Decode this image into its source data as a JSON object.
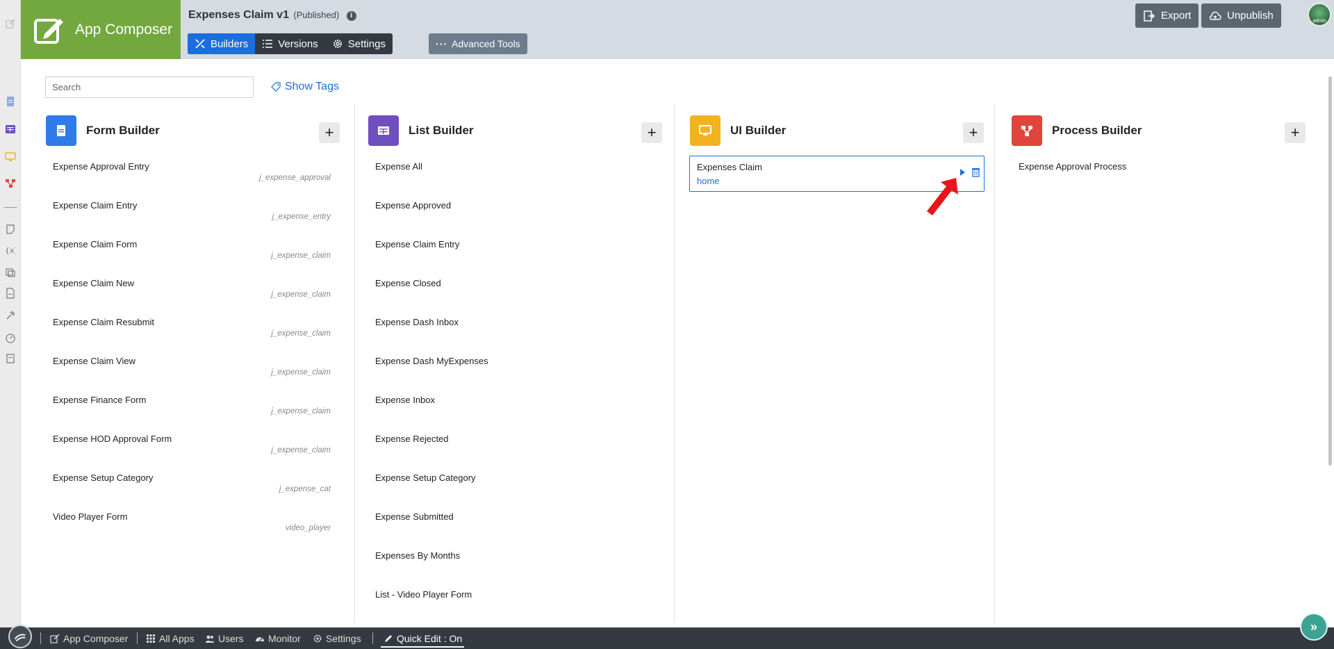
{
  "header": {
    "brand": "App Composer",
    "app_title": "Expenses Claim v1",
    "app_status": "(Published)",
    "tabs": [
      {
        "label": "Builders"
      },
      {
        "label": "Versions"
      },
      {
        "label": "Settings"
      }
    ],
    "advanced_tools": "Advanced Tools",
    "export_label": "Export",
    "unpublish_label": "Unpublish",
    "avatar_text": "admin"
  },
  "toolbar": {
    "search_placeholder": "Search",
    "show_tags": "Show Tags"
  },
  "columns": {
    "form": {
      "title": "Form Builder",
      "items": [
        {
          "name": "Expense Approval Entry",
          "table": "j_expense_approval"
        },
        {
          "name": "Expense Claim Entry",
          "table": "j_expense_entry"
        },
        {
          "name": "Expense Claim Form",
          "table": "j_expense_claim"
        },
        {
          "name": "Expense Claim New",
          "table": "j_expense_claim"
        },
        {
          "name": "Expense Claim Resubmit",
          "table": "j_expense_claim"
        },
        {
          "name": "Expense Claim View",
          "table": "j_expense_claim"
        },
        {
          "name": "Expense Finance Form",
          "table": "j_expense_claim"
        },
        {
          "name": "Expense HOD Approval Form",
          "table": "j_expense_claim"
        },
        {
          "name": "Expense Setup Category",
          "table": "j_expense_cat"
        },
        {
          "name": "Video Player Form",
          "table": "video_player"
        }
      ]
    },
    "list": {
      "title": "List Builder",
      "items": [
        {
          "name": "Expense All"
        },
        {
          "name": "Expense Approved"
        },
        {
          "name": "Expense Claim Entry"
        },
        {
          "name": "Expense Closed"
        },
        {
          "name": "Expense Dash Inbox"
        },
        {
          "name": "Expense Dash MyExpenses"
        },
        {
          "name": "Expense Inbox"
        },
        {
          "name": "Expense Rejected"
        },
        {
          "name": "Expense Setup Category"
        },
        {
          "name": "Expense Submitted"
        },
        {
          "name": "Expenses By Months"
        },
        {
          "name": "List - Video Player Form"
        }
      ]
    },
    "ui": {
      "title": "UI Builder",
      "items": [
        {
          "name": "Expenses Claim",
          "sub": "home"
        }
      ]
    },
    "process": {
      "title": "Process Builder",
      "items": [
        {
          "name": "Expense Approval Process"
        }
      ]
    }
  },
  "footer": {
    "app_composer": "App Composer",
    "all_apps": "All Apps",
    "users": "Users",
    "monitor": "Monitor",
    "settings": "Settings",
    "quick_edit": "Quick Edit : On"
  },
  "colors": {
    "brand": "#72a83e",
    "accent": "#1c6de0",
    "form_icon": "#2f7be8",
    "list_icon": "#6f4fbf",
    "ui_icon": "#f2b321",
    "process_icon": "#e0443a",
    "footer": "#343a40"
  }
}
